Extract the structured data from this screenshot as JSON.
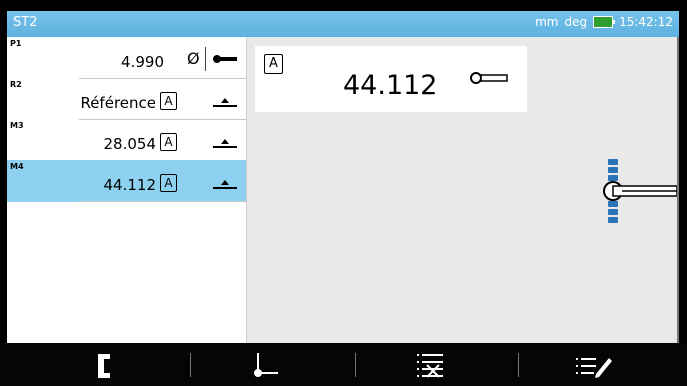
{
  "titlebar": {
    "title": "ST2",
    "units": "mm",
    "angle_units": "deg",
    "time": "15:42:12",
    "accent_color": "#5fb1df"
  },
  "features": [
    {
      "tag": "P1",
      "value": "4.990",
      "datum": "",
      "symbol": "Ø",
      "probe": "probe-icon"
    },
    {
      "tag": "R2",
      "value": "Référence",
      "datum": "A",
      "symbol": "",
      "probe": "plane-icon"
    },
    {
      "tag": "M3",
      "value": "28.054",
      "datum": "A",
      "symbol": "",
      "probe": "plane-icon"
    },
    {
      "tag": "M4",
      "value": "44.112",
      "datum": "A",
      "symbol": "",
      "probe": "plane-icon",
      "selected": true
    }
  ],
  "display": {
    "datum": "A",
    "value": "44.112"
  },
  "toolbar": {
    "buttons": [
      "bracket-icon",
      "point-probe-icon",
      "delete-list-icon",
      "edit-list-icon"
    ]
  },
  "colors": {
    "selected_row": "#8dd0ef",
    "title_blue": "#5fb1df"
  }
}
